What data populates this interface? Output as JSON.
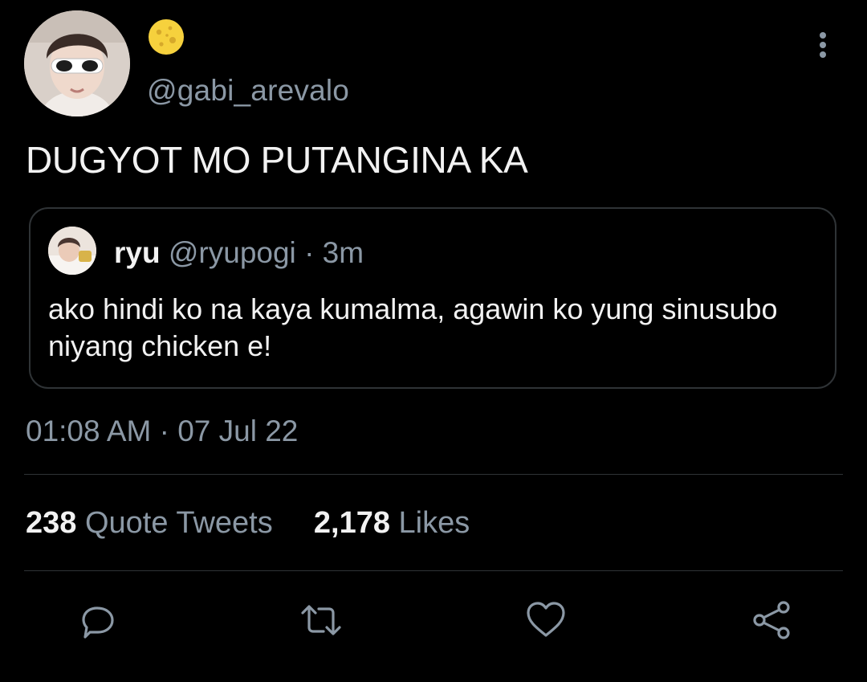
{
  "tweet": {
    "author": {
      "display_name_emoji": "🌕",
      "handle": "@gabi_arevalo"
    },
    "text": "DUGYOT MO PUTANGINA KA",
    "timestamp": "01:08 AM · 07 Jul 22"
  },
  "quoted_tweet": {
    "name": "ryu",
    "handle": "@ryupogi",
    "separator": "·",
    "time": "3m",
    "text": "ako hindi ko na kaya kumalma, agawin ko yung sinusubo niyang chicken e!"
  },
  "stats": {
    "quote_tweets_count": "238",
    "quote_tweets_label": "Quote Tweets",
    "likes_count": "2,178",
    "likes_label": "Likes"
  },
  "actions": [
    {
      "icon": "reply-icon"
    },
    {
      "icon": "retweet-icon"
    },
    {
      "icon": "like-icon"
    },
    {
      "icon": "share-icon"
    }
  ],
  "colors": {
    "background": "#000000",
    "text_primary": "#f2f2f2",
    "text_secondary": "#8b98a5",
    "border": "#2f3336",
    "emoji_moon": "#f6d13d"
  }
}
